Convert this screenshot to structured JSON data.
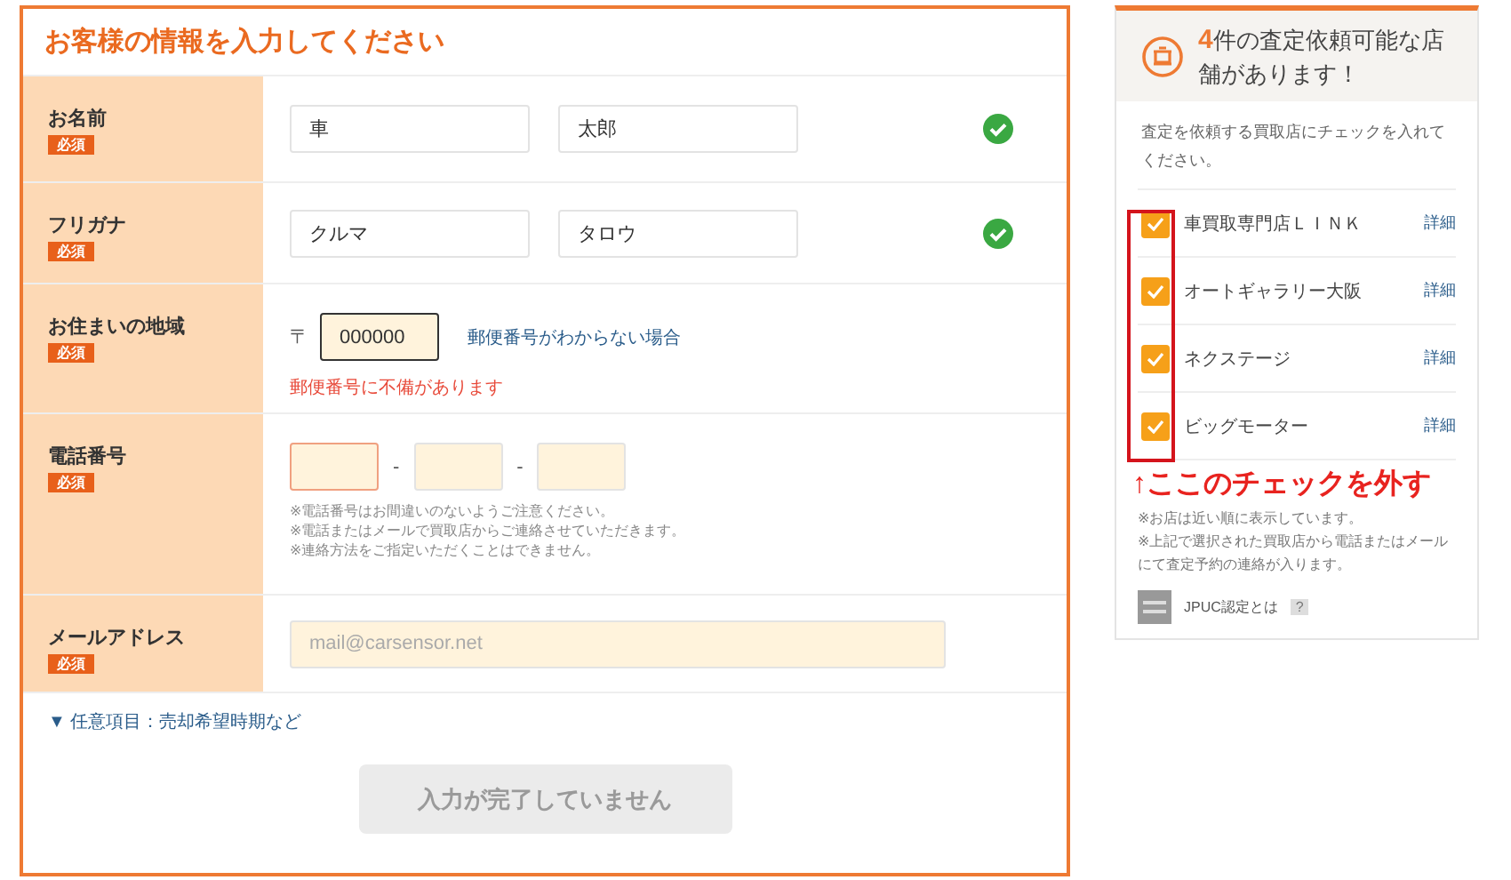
{
  "form": {
    "title": "お客様の情報を入力してください",
    "fields": [
      {
        "kind": "pair",
        "label": "お名前",
        "badge": "必須",
        "valid": true,
        "inputs": [
          {
            "value": "車",
            "error": false
          },
          {
            "value": "太郎",
            "error": false
          }
        ]
      },
      {
        "kind": "pair",
        "label": "フリガナ",
        "badge": "必須",
        "valid": true,
        "inputs": [
          {
            "value": "クルマ",
            "error": false
          },
          {
            "value": "タロウ",
            "error": false
          }
        ]
      },
      {
        "kind": "postal",
        "label": "お住まいの地域",
        "badge": "必須",
        "prefix": "〒",
        "inputs": [
          {
            "value": "000000",
            "error": true
          }
        ],
        "link": "郵便番号がわからない場合",
        "error_message": "郵便番号に不備があります"
      },
      {
        "kind": "phone",
        "label": "電話番号",
        "badge": "必須",
        "inputs": [
          {
            "error": true
          },
          {
            "error": false
          },
          {
            "error": false
          }
        ],
        "separators": [
          "-",
          "-"
        ],
        "notes": [
          "※電話番号はお間違いのないようご注意ください。",
          "※電話またはメールで買取店からご連絡させていただきます。",
          "※連絡方法をご指定いただくことはできません。"
        ]
      },
      {
        "kind": "email",
        "label": "メールアドレス",
        "badge": "必須",
        "inputs": [
          {
            "placeholder": "mail@carsensor.net",
            "error": false
          }
        ]
      }
    ],
    "optional_link": "▼ 任意項目：売却希望時期など",
    "submit": {
      "label": "入力が完了していません",
      "disabled": true
    }
  },
  "sidebar": {
    "count": "4",
    "heading": "件の査定依頼可能な店舗があります！",
    "intro": "査定を依頼する買取店にチェックを入れてください。",
    "shops": [
      {
        "name": "車買取専門店ＬＩＮＫ",
        "checked": true,
        "detail": "詳細"
      },
      {
        "name": "オートギャラリー大阪",
        "checked": true,
        "detail": "詳細"
      },
      {
        "name": "ネクステージ",
        "checked": true,
        "detail": "詳細"
      },
      {
        "name": "ビッグモーター",
        "checked": true,
        "detail": "詳細"
      }
    ],
    "notes": [
      "※お店は近い順に表示しています。",
      "※上記で選択された買取店から電話またはメールにて査定予約の連絡が入ります。"
    ],
    "jpuc_label": "JPUC認定とは",
    "help": "?"
  },
  "annotation": "↑ここのチェックを外す"
}
